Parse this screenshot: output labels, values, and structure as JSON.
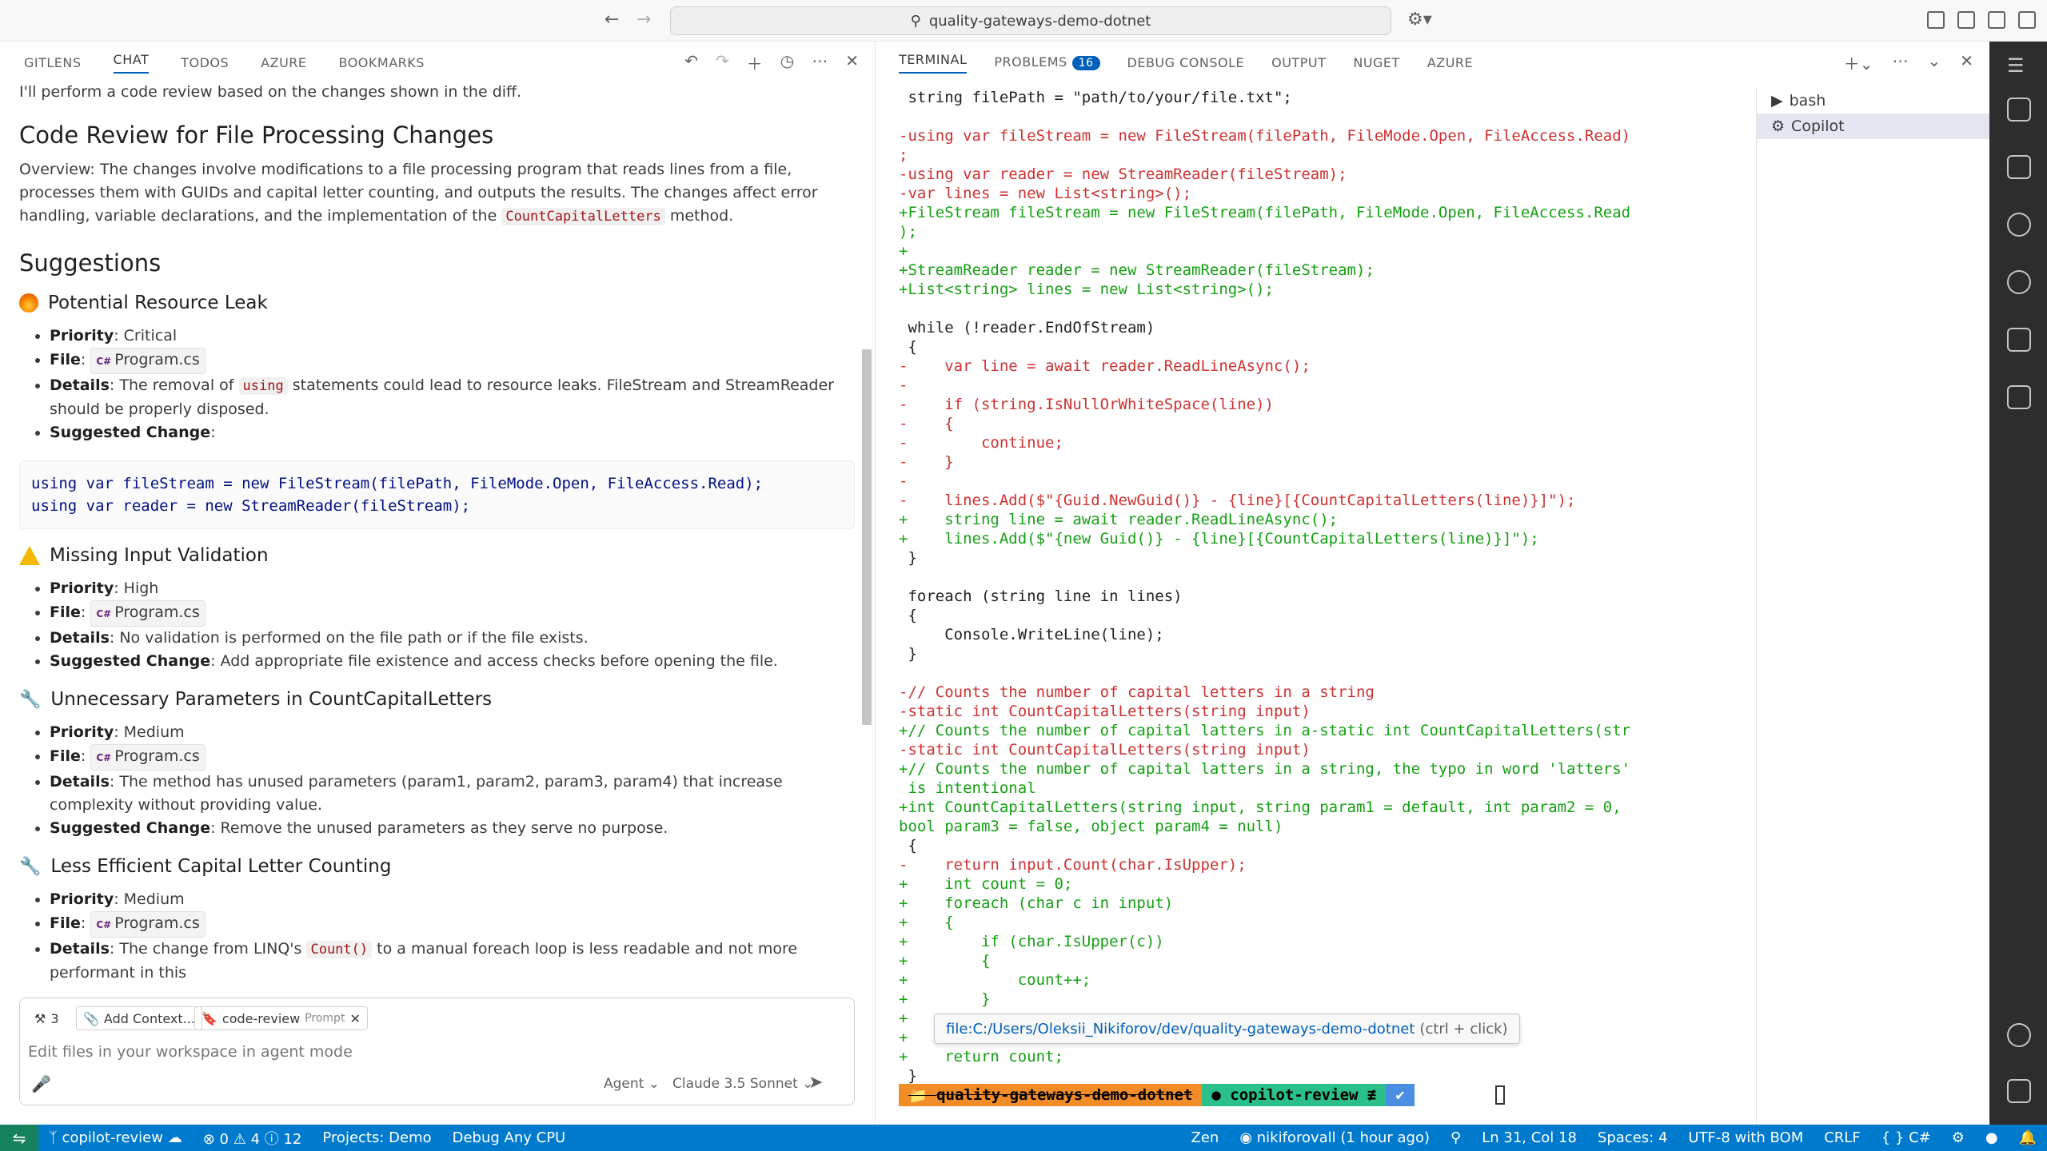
{
  "titlebar": {
    "search_text": "quality-gateways-demo-dotnet"
  },
  "left_tabs": [
    "GITLENS",
    "CHAT",
    "TODOS",
    "AZURE",
    "BOOKMARKS"
  ],
  "chat": {
    "intro": "I'll perform a code review based on the changes shown in the diff.",
    "title": "Code Review for File Processing Changes",
    "overview_prefix": "Overview: The changes involve modifications to a file processing program that reads lines from a file, processes them with GUIDs and capital letter counting, and outputs the results. The changes affect error handling, variable declarations, and the implementation of the ",
    "overview_code": "CountCapitalLetters",
    "overview_suffix": " method.",
    "suggestions_title": "Suggestions",
    "labels": {
      "priority": "Priority",
      "file": "File",
      "details": "Details",
      "suggested_change": "Suggested Change"
    },
    "file_name": "Program.cs",
    "issue1": {
      "title": "Potential Resource Leak",
      "priority": ": Critical",
      "details_prefix": ": The removal of ",
      "details_code": "using",
      "details_suffix": " statements could lead to resource leaks. FileStream and StreamReader should be properly disposed.",
      "suggested": ":",
      "code_line1": "using var fileStream = new FileStream(filePath, FileMode.Open, FileAccess.Read);",
      "code_line2": "using var reader = new StreamReader(fileStream);"
    },
    "issue2": {
      "title": "Missing Input Validation",
      "priority": ": High",
      "details": ": No validation is performed on the file path or if the file exists.",
      "suggested": ": Add appropriate file existence and access checks before opening the file."
    },
    "issue3": {
      "title": "Unnecessary Parameters in CountCapitalLetters",
      "priority": ": Medium",
      "details": ": The method has unused parameters (param1, param2, param3, param4) that increase complexity without providing value.",
      "suggested": ": Remove the unused parameters as they serve no purpose."
    },
    "issue4": {
      "title": "Less Efficient Capital Letter Counting",
      "priority": ": Medium",
      "details_prefix": ": The change from LINQ's ",
      "details_code": "Count()",
      "details_suffix": " to a manual foreach loop is less readable and not more performant in this"
    }
  },
  "chat_input": {
    "tools_count": "3",
    "add_context": "Add Context...",
    "prompt_chip": "code-review",
    "prompt_chip_tag": "Prompt",
    "placeholder": "Edit files in your workspace in agent mode",
    "mode": "Agent",
    "model": "Claude 3.5 Sonnet"
  },
  "term_tabs": {
    "terminal": "TERMINAL",
    "problems": "PROBLEMS",
    "problems_count": "16",
    "debug_console": "DEBUG CONSOLE",
    "output": "OUTPUT",
    "nuget": "NUGET",
    "azure": "AZURE"
  },
  "terminal_lines": [
    {
      "t": "ctx",
      "s": " string filePath = \"path/to/your/file.txt\";"
    },
    {
      "t": "ctx",
      "s": ""
    },
    {
      "t": "del",
      "s": "-using var fileStream = new FileStream(filePath, FileMode.Open, FileAccess.Read)"
    },
    {
      "t": "del",
      "s": ";"
    },
    {
      "t": "del",
      "s": "-using var reader = new StreamReader(fileStream);"
    },
    {
      "t": "del",
      "s": "-var lines = new List<string>();"
    },
    {
      "t": "add",
      "s": "+FileStream fileStream = new FileStream(filePath, FileMode.Open, FileAccess.Read"
    },
    {
      "t": "add",
      "s": ");"
    },
    {
      "t": "add",
      "s": "+"
    },
    {
      "t": "add",
      "s": "+StreamReader reader = new StreamReader(fileStream);"
    },
    {
      "t": "add",
      "s": "+List<string> lines = new List<string>();"
    },
    {
      "t": "ctx",
      "s": ""
    },
    {
      "t": "ctx",
      "s": " while (!reader.EndOfStream)"
    },
    {
      "t": "ctx",
      "s": " {"
    },
    {
      "t": "del",
      "s": "-    var line = await reader.ReadLineAsync();"
    },
    {
      "t": "del",
      "s": "-"
    },
    {
      "t": "del",
      "s": "-    if (string.IsNullOrWhiteSpace(line))"
    },
    {
      "t": "del",
      "s": "-    {"
    },
    {
      "t": "del",
      "s": "-        continue;"
    },
    {
      "t": "del",
      "s": "-    }"
    },
    {
      "t": "del",
      "s": "-"
    },
    {
      "t": "del",
      "s": "-    lines.Add($\"{Guid.NewGuid()} - {line}[{CountCapitalLetters(line)}]\");"
    },
    {
      "t": "add",
      "s": "+    string line = await reader.ReadLineAsync();"
    },
    {
      "t": "add",
      "s": "+    lines.Add($\"{new Guid()} - {line}[{CountCapitalLetters(line)}]\");"
    },
    {
      "t": "ctx",
      "s": " }"
    },
    {
      "t": "ctx",
      "s": ""
    },
    {
      "t": "ctx",
      "s": " foreach (string line in lines)"
    },
    {
      "t": "ctx",
      "s": " {"
    },
    {
      "t": "ctx",
      "s": "     Console.WriteLine(line);"
    },
    {
      "t": "ctx",
      "s": " }"
    },
    {
      "t": "ctx",
      "s": ""
    },
    {
      "t": "del",
      "s": "-// Counts the number of capital letters in a string"
    },
    {
      "t": "del",
      "s": "-static int CountCapitalLetters(string input)"
    },
    {
      "t": "add",
      "s": "+// Counts the number of capital latters in a-static int CountCapitalLetters(str"
    },
    {
      "t": "del",
      "s": "-static int CountCapitalLetters(string input)"
    },
    {
      "t": "add",
      "s": "+// Counts the number of capital latters in a string, the typo in word 'latters'"
    },
    {
      "t": "add",
      "s": " is intentional"
    },
    {
      "t": "add",
      "s": "+int CountCapitalLetters(string input, string param1 = default, int param2 = 0,"
    },
    {
      "t": "add",
      "s": "bool param3 = false, object param4 = null)"
    },
    {
      "t": "ctx",
      "s": " {"
    },
    {
      "t": "del",
      "s": "-    return input.Count(char.IsUpper);"
    },
    {
      "t": "add",
      "s": "+    int count = 0;"
    },
    {
      "t": "add",
      "s": "+    foreach (char c in input)"
    },
    {
      "t": "add",
      "s": "+    {"
    },
    {
      "t": "add",
      "s": "+        if (char.IsUpper(c))"
    },
    {
      "t": "add",
      "s": "+        {"
    },
    {
      "t": "add",
      "s": "+            count++;"
    },
    {
      "t": "add",
      "s": "+        }"
    },
    {
      "t": "add",
      "s": "+"
    },
    {
      "t": "add",
      "s": "+"
    },
    {
      "t": "add",
      "s": "+    return count;"
    },
    {
      "t": "ctx",
      "s": " }"
    }
  ],
  "terminal_list": [
    "bash",
    "Copilot"
  ],
  "tooltip": {
    "link": "file:C:/Users/Oleksii_Nikiforov/dev/quality-gateways-demo-dotnet",
    "hint": "(ctrl + click)"
  },
  "prompt": {
    "dir": "quality-gateways-demo-dotnet",
    "branch": "copilot-review ≢",
    "status": "✔"
  },
  "statusbar": {
    "branch": "copilot-review",
    "errors": "0",
    "warnings": "4",
    "infos": "12",
    "projects": "Projects: Demo",
    "debug": "Debug Any CPU",
    "zen": "Zen",
    "blame": "nikiforovall (1 hour ago)",
    "position": "Ln 31, Col 18",
    "spaces": "Spaces: 4",
    "encoding": "UTF-8 with BOM",
    "eol": "CRLF",
    "language": "C#"
  },
  "colors": {
    "accent": "#005fb8",
    "statusbar": "#007acc",
    "diff_del": "#cd3131",
    "diff_add": "#14a012"
  }
}
